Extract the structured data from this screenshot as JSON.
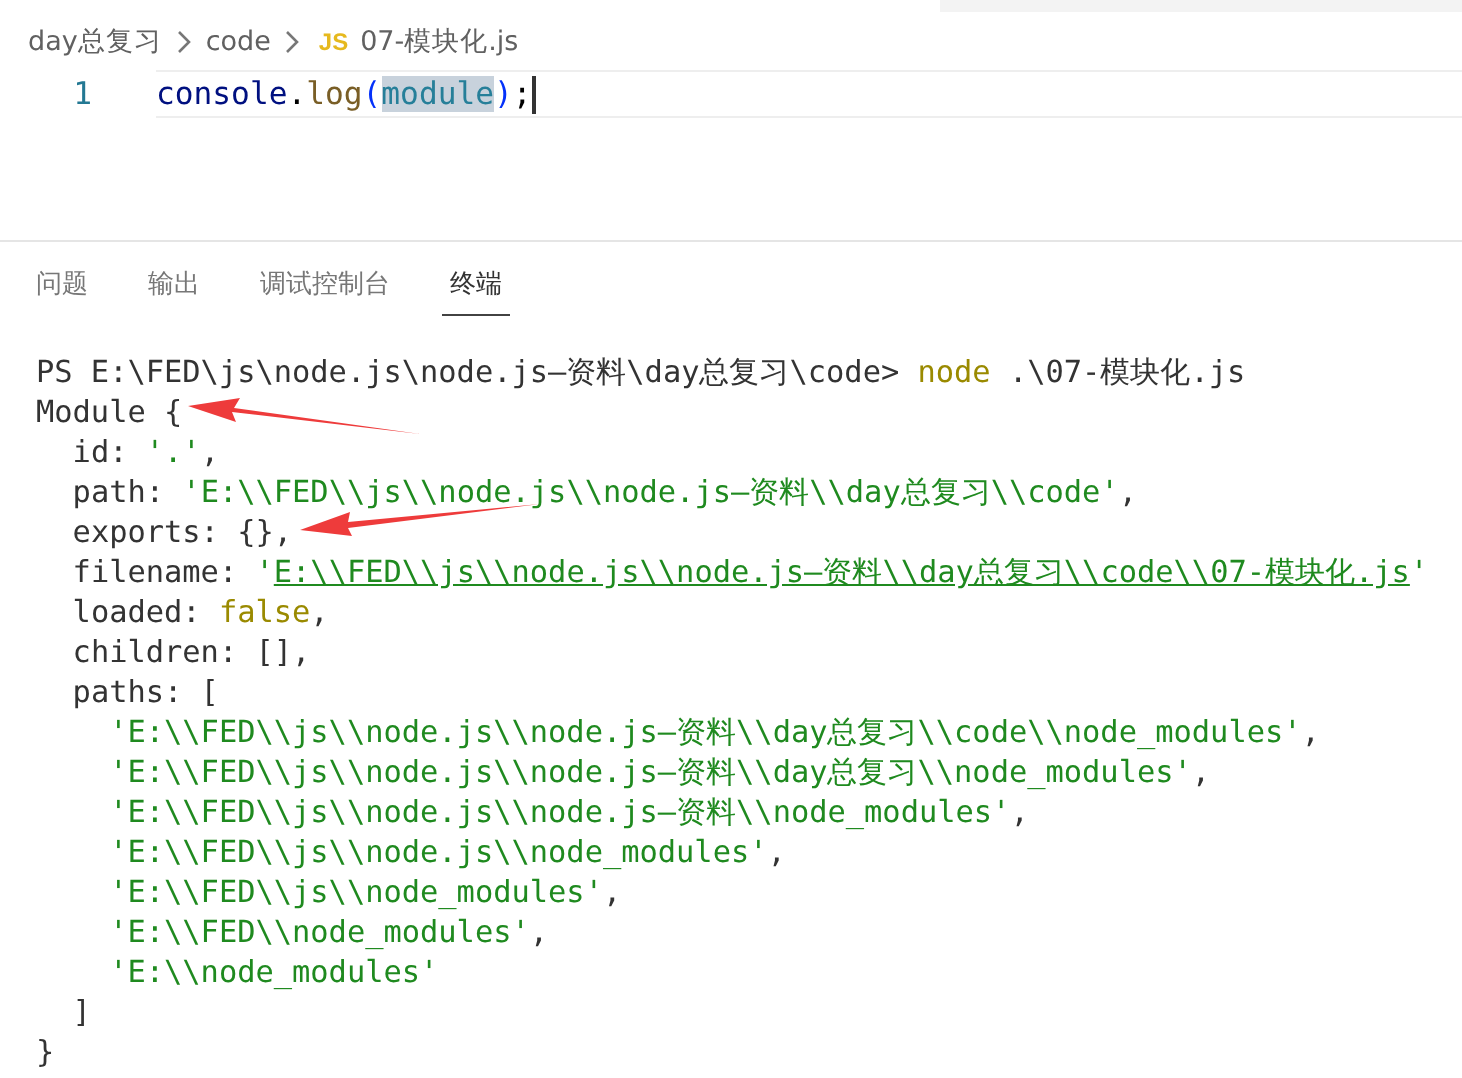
{
  "breadcrumb": {
    "items": [
      "day总复习",
      "code"
    ],
    "file_badge": "JS",
    "file": "07-模块化.js"
  },
  "editor": {
    "lines": [
      {
        "number": "1",
        "tokens": [
          {
            "text": "console",
            "kind": "variable",
            "selected": false
          },
          {
            "text": ".",
            "kind": "plain",
            "selected": false
          },
          {
            "text": "log",
            "kind": "function",
            "selected": false
          },
          {
            "text": "(",
            "kind": "bracket",
            "selected": false
          },
          {
            "text": "module",
            "kind": "variable2",
            "selected": true
          },
          {
            "text": ")",
            "kind": "bracket",
            "selected": false
          },
          {
            "text": ";",
            "kind": "plain",
            "selected": false
          }
        ]
      }
    ]
  },
  "panel_tabs": [
    {
      "label": "问题",
      "selected": false
    },
    {
      "label": "输出",
      "selected": false
    },
    {
      "label": "调试控制台",
      "selected": false
    },
    {
      "label": "终端",
      "selected": true
    }
  ],
  "terminal": {
    "lines": [
      [
        {
          "text": "PS E:\\FED\\js\\node.js\\node.js—资料\\day总复习\\code> ",
          "kind": "plain"
        },
        {
          "text": "node",
          "kind": "keyword"
        },
        {
          "text": " .\\07-模块化.js",
          "kind": "plain"
        }
      ],
      [
        {
          "text": "Module {",
          "kind": "plain"
        }
      ],
      [
        {
          "text": "  id: ",
          "kind": "plain"
        },
        {
          "text": "'.'",
          "kind": "string"
        },
        {
          "text": ",",
          "kind": "plain"
        }
      ],
      [
        {
          "text": "  path: ",
          "kind": "plain"
        },
        {
          "text": "'E:\\\\FED\\\\js\\\\node.js\\\\node.js—资料\\\\day总复习\\\\code'",
          "kind": "string"
        },
        {
          "text": ",",
          "kind": "plain"
        }
      ],
      [
        {
          "text": "  exports: {},",
          "kind": "plain"
        }
      ],
      [
        {
          "text": "  filename: ",
          "kind": "plain"
        },
        {
          "text": "'",
          "kind": "string"
        },
        {
          "text": "E:\\\\FED\\\\js\\\\node.js\\\\node.js—资料\\\\day总复习\\\\code\\\\07-模块化.js",
          "kind": "link"
        },
        {
          "text": "'",
          "kind": "string"
        }
      ],
      [
        {
          "text": "  loaded: ",
          "kind": "plain"
        },
        {
          "text": "false",
          "kind": "keyword"
        },
        {
          "text": ",",
          "kind": "plain"
        }
      ],
      [
        {
          "text": "  children: [],",
          "kind": "plain"
        }
      ],
      [
        {
          "text": "  paths: [",
          "kind": "plain"
        }
      ],
      [
        {
          "text": "    'E:\\\\FED\\\\js\\\\node.js\\\\node.js—资料\\\\day总复习\\\\code\\\\node_modules'",
          "kind": "string"
        },
        {
          "text": ",",
          "kind": "plain"
        }
      ],
      [
        {
          "text": "    'E:\\\\FED\\\\js\\\\node.js\\\\node.js—资料\\\\day总复习\\\\node_modules'",
          "kind": "string"
        },
        {
          "text": ",",
          "kind": "plain"
        }
      ],
      [
        {
          "text": "    'E:\\\\FED\\\\js\\\\node.js\\\\node.js—资料\\\\node_modules'",
          "kind": "string"
        },
        {
          "text": ",",
          "kind": "plain"
        }
      ],
      [
        {
          "text": "    'E:\\\\FED\\\\js\\\\node.js\\\\node_modules'",
          "kind": "string"
        },
        {
          "text": ",",
          "kind": "plain"
        }
      ],
      [
        {
          "text": "    'E:\\\\FED\\\\js\\\\node_modules'",
          "kind": "string"
        },
        {
          "text": ",",
          "kind": "plain"
        }
      ],
      [
        {
          "text": "    'E:\\\\FED\\\\node_modules'",
          "kind": "string"
        },
        {
          "text": ",",
          "kind": "plain"
        }
      ],
      [
        {
          "text": "    'E:\\\\node_modules'",
          "kind": "string"
        }
      ],
      [
        {
          "text": "  ]",
          "kind": "plain"
        }
      ],
      [
        {
          "text": "}",
          "kind": "plain"
        }
      ]
    ]
  }
}
